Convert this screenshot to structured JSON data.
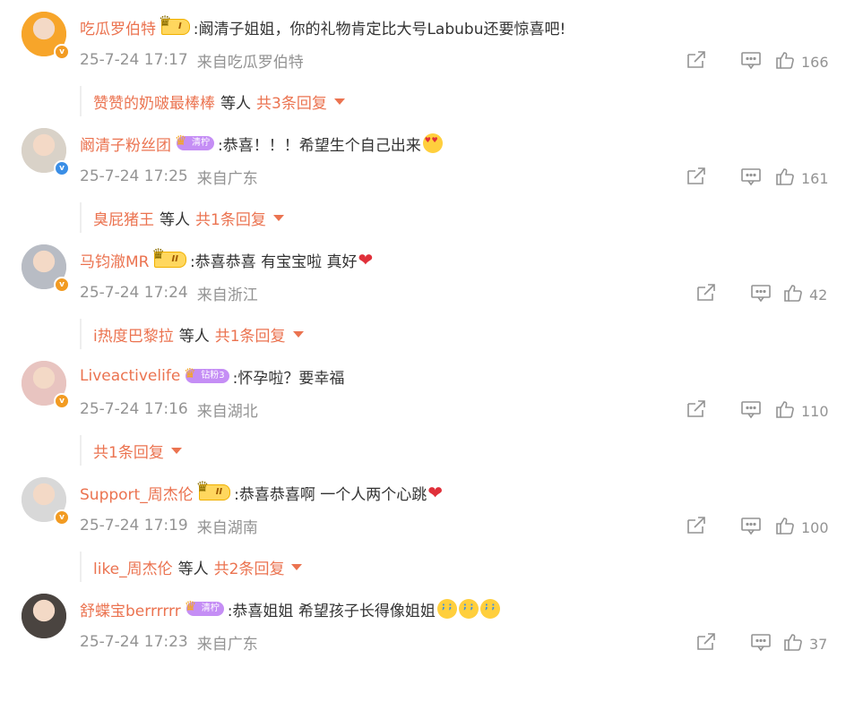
{
  "colors": {
    "accent": "#eb7350",
    "meta": "#939393",
    "vip_gold": "#ffd75e",
    "fan_purple": "#c58ef5"
  },
  "comments": [
    {
      "user": "吃瓜罗伯特",
      "badge_type": "vip",
      "badge_text": "I",
      "text": ":阚清子姐姐，你的礼物肯定比大号Labubu还要惊喜吧!",
      "emoji": "",
      "date": "25-7-24 17:17",
      "source": "来自吃瓜罗伯特",
      "likes": "166",
      "verify": "gold",
      "reply_user": "赞赞的奶啵最棒棒",
      "reply_mid": "等人",
      "reply_count": "共3条回复",
      "avatar_color": "#f7a52a"
    },
    {
      "user": "阚清子粉丝团",
      "badge_type": "fan",
      "badge_text": "清柠",
      "text": ":恭喜！！！希望生个自己出来",
      "emoji": "heart-eyes",
      "date": "25-7-24 17:25",
      "source": "来自广东",
      "likes": "161",
      "verify": "blue",
      "reply_user": "臭屁猪王",
      "reply_mid": "等人",
      "reply_count": "共1条回复",
      "avatar_color": "#d9d2c8"
    },
    {
      "user": "马钧澈MR",
      "badge_type": "vip",
      "badge_text": "II",
      "text": ":恭喜恭喜 有宝宝啦 真好",
      "emoji": "heart",
      "date": "25-7-24 17:24",
      "source": "来自浙江",
      "likes": "42",
      "verify": "gold",
      "reply_user": "i热度巴黎拉",
      "reply_mid": "等人",
      "reply_count": "共1条回复",
      "avatar_color": "#b8bcc4"
    },
    {
      "user": "Liveactivelife",
      "badge_type": "fan",
      "badge_text": "钻粉3",
      "text": ":怀孕啦？要幸福",
      "emoji": "",
      "date": "25-7-24 17:16",
      "source": "来自湖北",
      "likes": "110",
      "verify": "gold",
      "reply_user": "",
      "reply_mid": "",
      "reply_count": "共1条回复",
      "avatar_color": "#e8c4c0"
    },
    {
      "user": "Support_周杰伦",
      "badge_type": "vip",
      "badge_text": "II",
      "text": ":恭喜恭喜啊 一个人两个心跳",
      "emoji": "heart",
      "date": "25-7-24 17:19",
      "source": "来自湖南",
      "likes": "100",
      "verify": "gold",
      "reply_user": "like_周杰伦",
      "reply_mid": "等人",
      "reply_count": "共2条回复",
      "avatar_color": "#d8d8d8"
    },
    {
      "user": "舒蝶宝berrrrrr",
      "badge_type": "fan",
      "badge_text": "清柠",
      "text": ":恭喜姐姐 希望孩子长得像姐姐",
      "emoji": "cry3",
      "date": "25-7-24 17:23",
      "source": "来自广东",
      "likes": "37",
      "verify": "",
      "reply_user": "",
      "reply_mid": "",
      "reply_count": "",
      "avatar_color": "#4a4440"
    }
  ],
  "icons": {
    "share": "share-icon",
    "comment": "comment-icon",
    "like": "like-icon"
  }
}
